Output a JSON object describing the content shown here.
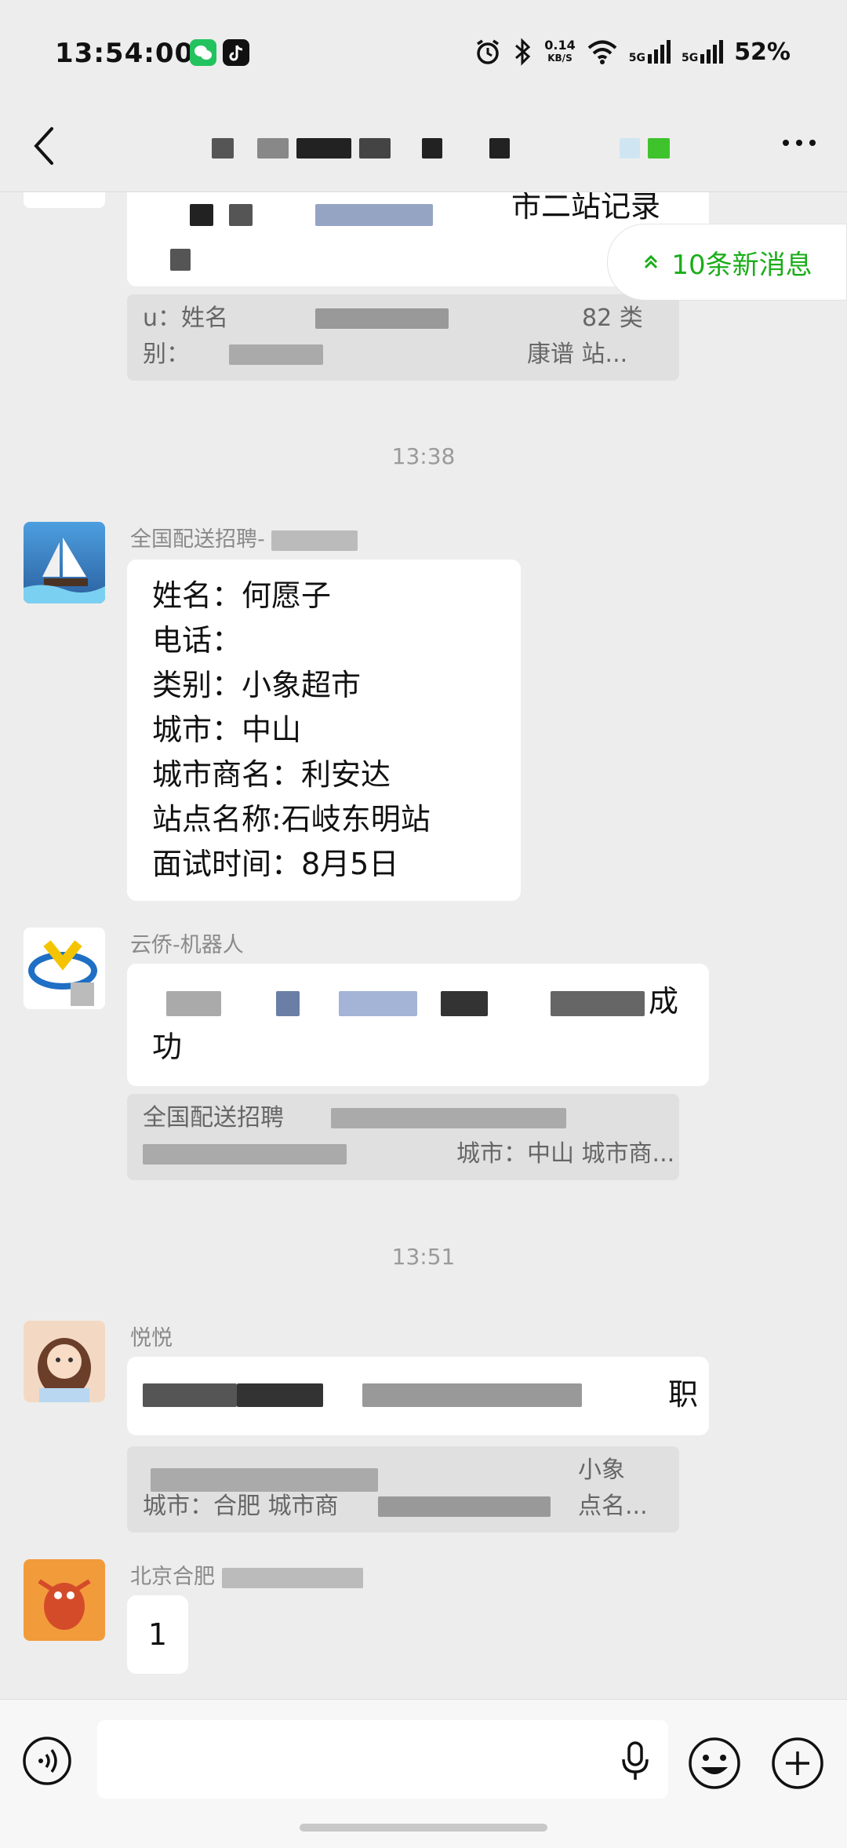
{
  "status": {
    "time": "13:54:00",
    "net_speed_value": "0.14",
    "net_speed_unit": "KB/S",
    "signal1_label": "5G",
    "signal2_label": "5G",
    "battery": "52%"
  },
  "new_messages": {
    "label": "10条新消息"
  },
  "messages": {
    "top_quote_partial_title": "市二站记录",
    "top_quote_line1_start": "u：姓名",
    "top_quote_line1_end": "82 类",
    "top_quote_line2_start": "别：",
    "top_quote_line2_end": "康谱 站...",
    "time1": "13:38",
    "msg1_sender": "全国配送招聘-",
    "msg1_lines": [
      "姓名：何愿子",
      "电话：",
      "类别：小象超市",
      "城市：中山",
      "城市商名：利安达",
      "站点名称:石岐东明站",
      "面试时间：8月5日"
    ],
    "msg2_sender": "云侨-机器人",
    "msg2_line1_tail": "成",
    "msg2_line2": "功",
    "msg2_quote_line1": "全国配送招聘",
    "msg2_quote_line2_end": "城市：中山 城市商...",
    "time2": "13:51",
    "msg3_sender": "悦悦",
    "msg3_tail": "职",
    "msg3_quote_right1": "小象",
    "msg3_quote_line2": "城市：合肥 城市商",
    "msg3_quote_right2": "点名...",
    "msg4_sender": "北京合肥",
    "msg4_text": "1"
  }
}
